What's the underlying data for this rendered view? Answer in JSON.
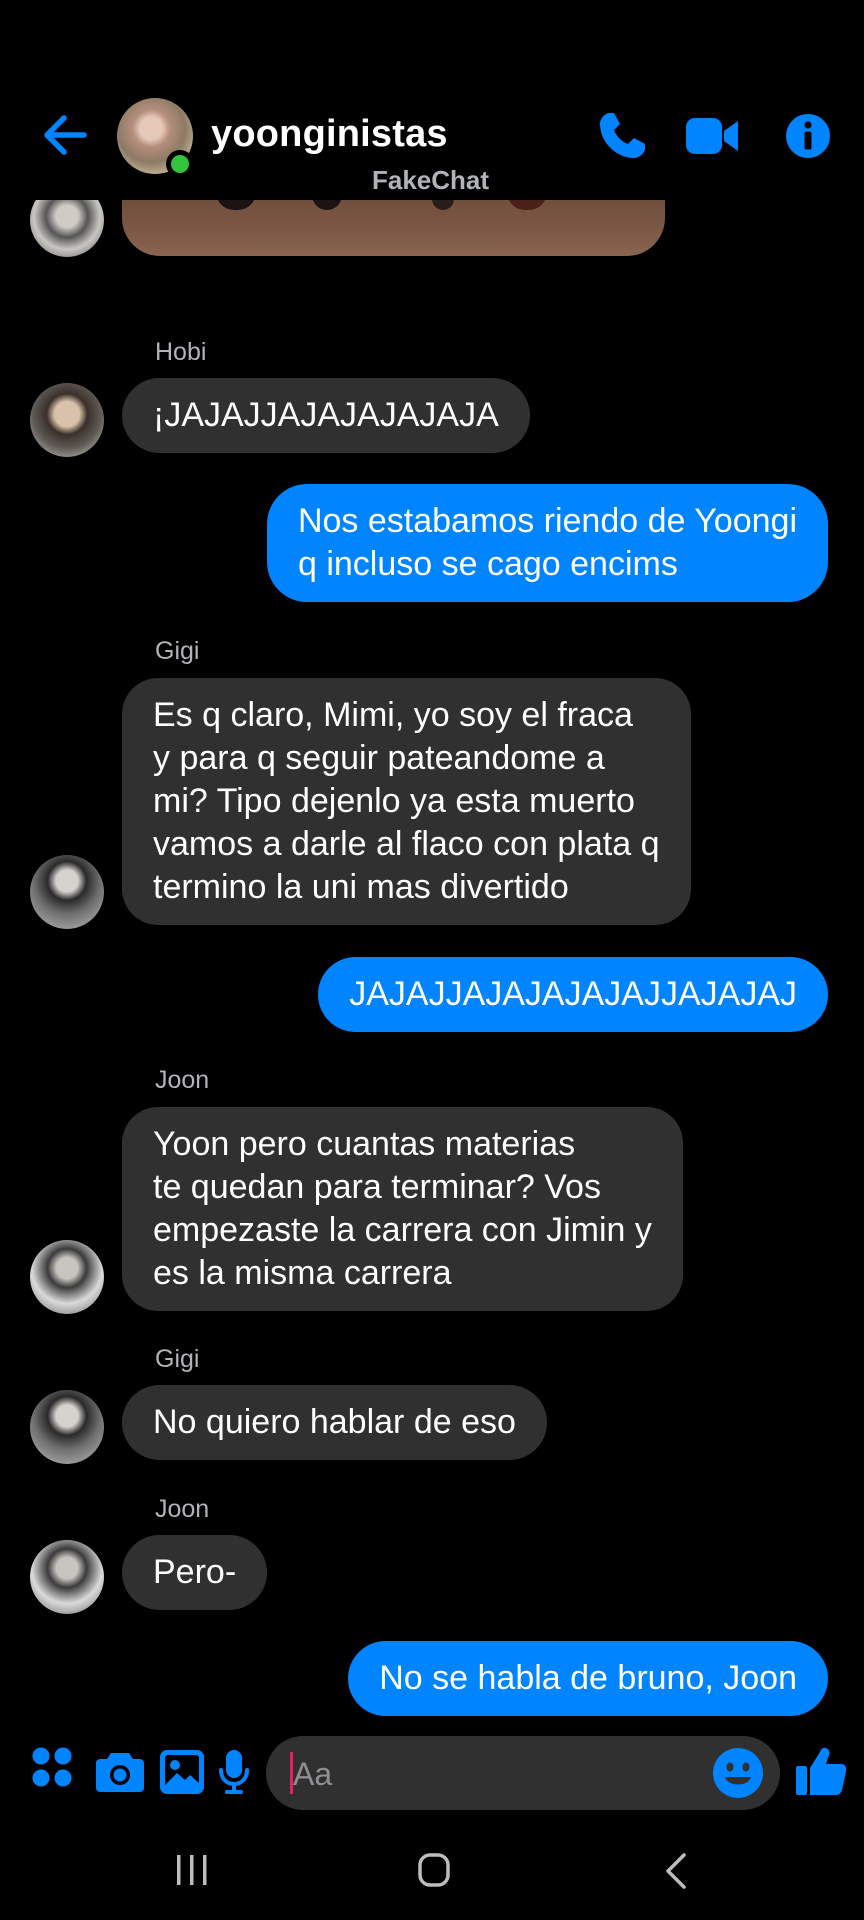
{
  "header": {
    "title": "yoonginistas",
    "subtitle": "FakeChat",
    "accent_color": "#0084ff",
    "online_color": "#31c43c"
  },
  "messages": [
    {
      "direction": "incoming",
      "sender": "Hobi",
      "text": "¡JAJAJJAJAJAJAJAJA"
    },
    {
      "direction": "outgoing",
      "text": "Nos estabamos riendo de Yoongi\nq incluso se cago encims"
    },
    {
      "direction": "incoming",
      "sender": "Gigi",
      "text": "Es q claro, Mimi, yo soy el fraca\ny para q seguir pateandome a\nmi? Tipo dejenlo ya esta muerto\nvamos a darle al flaco con plata q\ntermino la uni mas divertido"
    },
    {
      "direction": "outgoing",
      "text": "JAJAJJAJAJAJAJAJJAJAJAJ"
    },
    {
      "direction": "incoming",
      "sender": "Joon",
      "text": "Yoon pero cuantas materias\nte quedan para terminar? Vos\nempezaste la carrera con Jimin y\nes la misma carrera"
    },
    {
      "direction": "incoming",
      "sender": "Gigi",
      "text": "No quiero hablar de eso"
    },
    {
      "direction": "incoming",
      "sender": "Joon",
      "text": "Pero-"
    },
    {
      "direction": "outgoing",
      "text": "No se habla de bruno, Joon"
    }
  ],
  "composer": {
    "placeholder": "Aa",
    "icons": [
      "apps-icon",
      "camera-icon",
      "gallery-icon",
      "microphone-icon",
      "emoji-icon",
      "like-icon"
    ]
  },
  "navbar": {
    "icons": [
      "recents-icon",
      "home-icon",
      "back-icon"
    ]
  }
}
